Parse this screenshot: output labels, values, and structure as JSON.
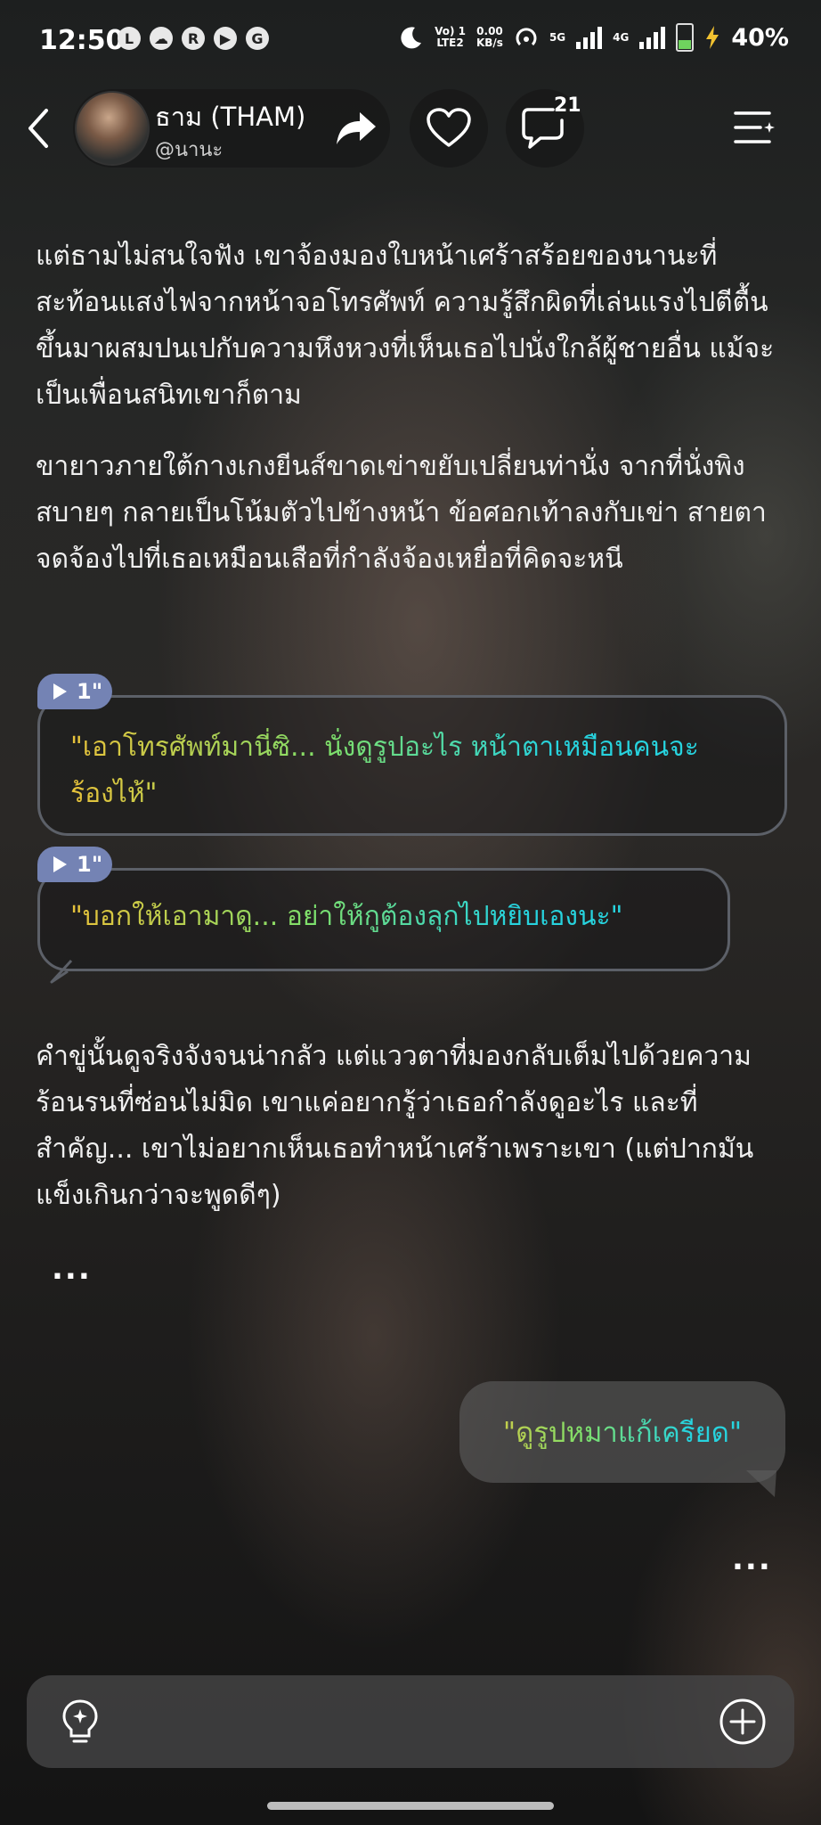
{
  "status_bar": {
    "time": "12:50",
    "app_icons": [
      "line-icon",
      "cloud-icon",
      "r-icon",
      "play-icon",
      "g-icon"
    ],
    "app_letters": [
      "L",
      "☁",
      "R",
      "▶",
      "G"
    ],
    "network": {
      "volte_top": "Vo) 1",
      "volte_bottom": "LTE2",
      "speed_top": "0.00",
      "speed_bottom": "KB/s",
      "sim1": "5G",
      "sim2": "4G"
    },
    "battery": "40%",
    "battery_color": "#6fd35e"
  },
  "header": {
    "character_name": "ธาม (THAM)",
    "handle": "@นานะ",
    "comment_count": "21"
  },
  "story": {
    "paragraphs": [
      "แต่ธามไม่สนใจฟัง เขาจ้องมองใบหน้าเศร้าสร้อยของนานะที่สะท้อนแสงไฟจากหน้าจอโทรศัพท์ ความรู้สึกผิดที่เล่นแรงไปตีตื้นขึ้นมาผสมปนเปกับความหึงหวงที่เห็นเธอไปนั่งใกล้ผู้ชายอื่น แม้จะเป็นเพื่อนสนิทเขาก็ตาม",
      "ขายาวภายใต้กางเกงยีนส์ขาดเข่าขยับเปลี่ยนท่านั่ง จากที่นั่งพิงสบายๆ กลายเป็นโน้มตัวไปข้างหน้า ข้อศอกเท้าลงกับเข่า สายตาจดจ้องไปที่เธอเหมือนเสือที่กำลังจ้องเหยื่อที่คิดจะหนี",
      "คำขู่นั้นดูจริงจังจนน่ากลัว แต่แววตาที่มองกลับเต็มไปด้วยความร้อนรนที่ซ่อนไม่มิด เขาแค่อยากรู้ว่าเธอกำลังดูอะไร และที่สำคัญ... เขาไม่อยากเห็นเธอทำหน้าเศร้าเพราะเขา (แต่ปากมันแข็งเกินกว่าจะพูดดีๆ)"
    ],
    "dialogues": [
      {
        "duration": "1\"",
        "text": "\"เอาโทรศัพท์มานี่ซิ... นั่งดูรูปอะไร หน้าตาเหมือนคนจะร้องไห้\""
      },
      {
        "duration": "1\"",
        "text": "\"บอกให้เอามาดู... อย่าให้กูต้องลุกไปหยิบเองนะ\""
      }
    ],
    "ellipsis_ai": "...",
    "user_message": "\"ดูรูปหมาแก้เครียด\"",
    "ellipsis_user": "...",
    "accent_gradient": [
      "#e8c23a",
      "#7ee06b",
      "#27d3de"
    ],
    "badge_color": "#7483b4"
  },
  "input": {
    "left_icon": "lightbulb-icon",
    "right_icon": "plus-circle-icon"
  }
}
